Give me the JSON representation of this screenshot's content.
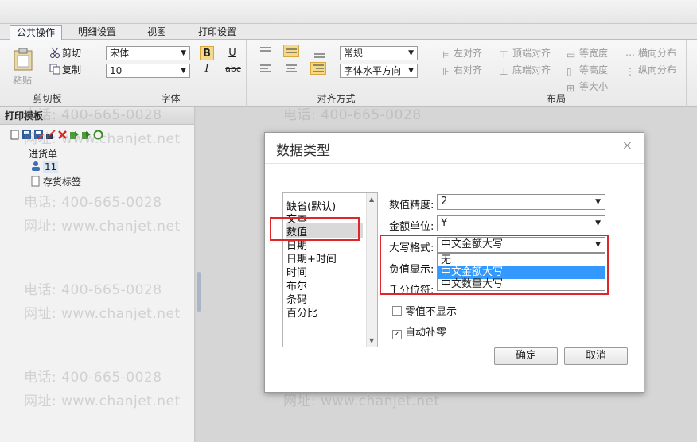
{
  "ribbon": {
    "tabs": [
      "公共操作",
      "明细设置",
      "视图",
      "打印设置"
    ],
    "clipboard": {
      "paste": "粘贴",
      "cut": "剪切",
      "copy": "复制",
      "label": "剪切板"
    },
    "font": {
      "name": "宋体",
      "size": "10",
      "bold": "B",
      "underline": "U",
      "italic": "I",
      "strike": "abc",
      "label": "字体"
    },
    "align": {
      "style": "常规",
      "horizontal": "字体水平方向",
      "label": "对齐方式"
    },
    "layout": {
      "left": "左对齐",
      "right": "右对齐",
      "top": "顶端对齐",
      "bottom": "底端对齐",
      "same_width": "等宽度",
      "same_height": "等高度",
      "same_size": "等大小",
      "h_dist": "横向分布",
      "v_dist": "纵向分布",
      "label": "布局"
    }
  },
  "left_panel": {
    "title": "打印模板",
    "tree": {
      "root": "进货单",
      "child1": "11",
      "child2": "存货标签"
    }
  },
  "watermark": {
    "phone": "电话: 400-665-0028",
    "site": "网址: www.chanjet.net"
  },
  "dialog": {
    "title": "数据类型",
    "close": "×",
    "types": [
      "缺省(默认)",
      "文本",
      "数值",
      "日期",
      "日期+时间",
      "时间",
      "布尔",
      "条码",
      "百分比"
    ],
    "precision_label": "数值精度:",
    "precision_value": "2",
    "currency_label": "金额单位:",
    "currency_value": "¥",
    "uppercase_label": "大写格式:",
    "uppercase_value": "中文金额大写",
    "uppercase_options": [
      "无",
      "中文金额大写",
      "中文数量大写"
    ],
    "negative_label": "负值显示:",
    "thousands_label": "千分位符:",
    "zero_hide": "零值不显示",
    "auto_pad": "自动补零",
    "ok": "确定",
    "cancel": "取消"
  }
}
